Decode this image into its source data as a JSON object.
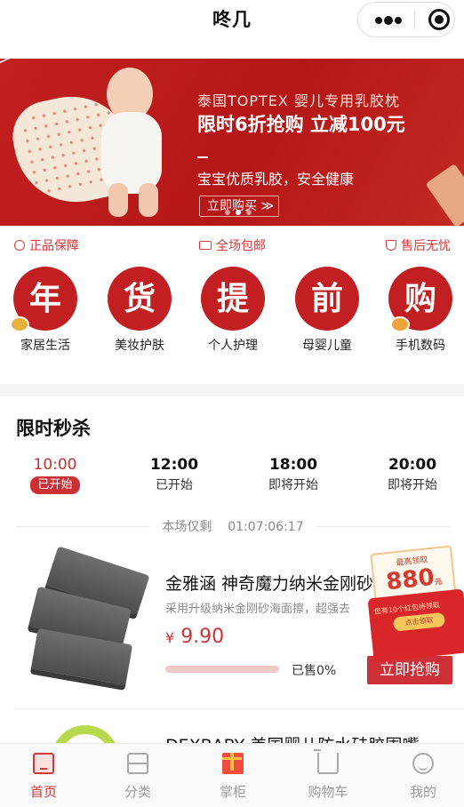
{
  "app": {
    "title": "咚几"
  },
  "banner": {
    "subtitle": "泰国TOPTEX 婴儿专用乳胶枕",
    "headline": "限时6折抢购 立减100元",
    "desc": "宝宝优质乳胶，安全健康",
    "button": "立即购买 ≫",
    "page_dots": 3,
    "active_dot": 2
  },
  "guarantees": [
    {
      "label": "正品保障",
      "icon": "authentic-icon"
    },
    {
      "label": "全场包邮",
      "icon": "truck-icon"
    },
    {
      "label": "售后无忧",
      "icon": "shield-icon"
    }
  ],
  "categories": [
    {
      "char": "年",
      "label": "家居生活"
    },
    {
      "char": "货",
      "label": "美妆护肤"
    },
    {
      "char": "提",
      "label": "个人护理"
    },
    {
      "char": "前",
      "label": "母婴儿童"
    },
    {
      "char": "购",
      "label": "手机数码"
    }
  ],
  "flash_sale": {
    "title": "限时秒杀",
    "slots": [
      {
        "time": "10:00",
        "status": "已开始",
        "active": true
      },
      {
        "time": "12:00",
        "status": "已开始",
        "active": false
      },
      {
        "time": "18:00",
        "status": "即将开始",
        "active": false
      },
      {
        "time": "20:00",
        "status": "即将开始",
        "active": false
      }
    ],
    "remain_label": "本场仅剩",
    "remain_time": "01:07:06:17",
    "product": {
      "name": "金雅涵 神奇魔力纳米金刚砂",
      "desc": "采用升级纳米金刚砂海面擦，超强去",
      "currency": "¥",
      "price": "9.90",
      "sold": "已售0%",
      "sold_fraction": 0,
      "buy": "立即抢购"
    },
    "next_product": {
      "name": "DEXBABY 美国婴儿防水硅胶围嘴"
    }
  },
  "red_packet": {
    "top": "最高领取",
    "amount": "880",
    "unit": "元",
    "message": "您有10个红包待领取",
    "button": "点击领取"
  },
  "tabbar": [
    {
      "label": "首页",
      "icon": "home-icon",
      "active": true
    },
    {
      "label": "分类",
      "icon": "category-icon",
      "active": false
    },
    {
      "label": "掌柜",
      "icon": "gift-icon",
      "active": false
    },
    {
      "label": "购物车",
      "icon": "cart-icon",
      "active": false
    },
    {
      "label": "我的",
      "icon": "profile-icon",
      "active": false
    }
  ],
  "colors": {
    "accent": "#d2373a",
    "banner_red": "#b41718"
  }
}
